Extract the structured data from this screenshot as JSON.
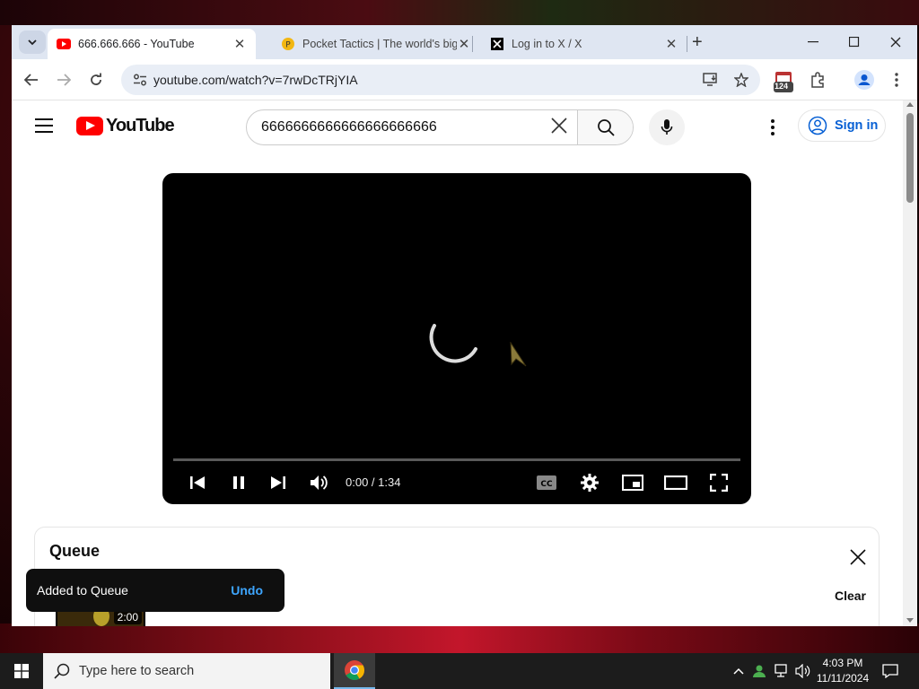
{
  "browser": {
    "tabs": [
      {
        "title": "666.666.666 - YouTube",
        "active": true
      },
      {
        "title": "Pocket Tactics | The world's big",
        "active": false
      },
      {
        "title": "Log in to X / X",
        "active": false
      }
    ],
    "url": "youtube.com/watch?v=7rwDcTRjYIA",
    "extension_badge": "124"
  },
  "youtube": {
    "logo_text": "YouTube",
    "search_query": "6666666666666666666666",
    "signin_label": "Sign in",
    "player": {
      "time": "0:00 / 1:34",
      "progress": 0,
      "state": "buffering",
      "cc_label": "CC"
    },
    "queue": {
      "title": "Queue",
      "clear_label": "Clear",
      "item_duration": "2:00"
    },
    "toast": {
      "message": "Added to Queue",
      "action": "Undo"
    },
    "colors": {
      "brand": "#ff0000",
      "link": "#065fd4",
      "toast_action": "#3ea6ff"
    }
  },
  "taskbar": {
    "search_placeholder": "Type here to search",
    "time": "4:03 PM",
    "date": "11/11/2024"
  }
}
